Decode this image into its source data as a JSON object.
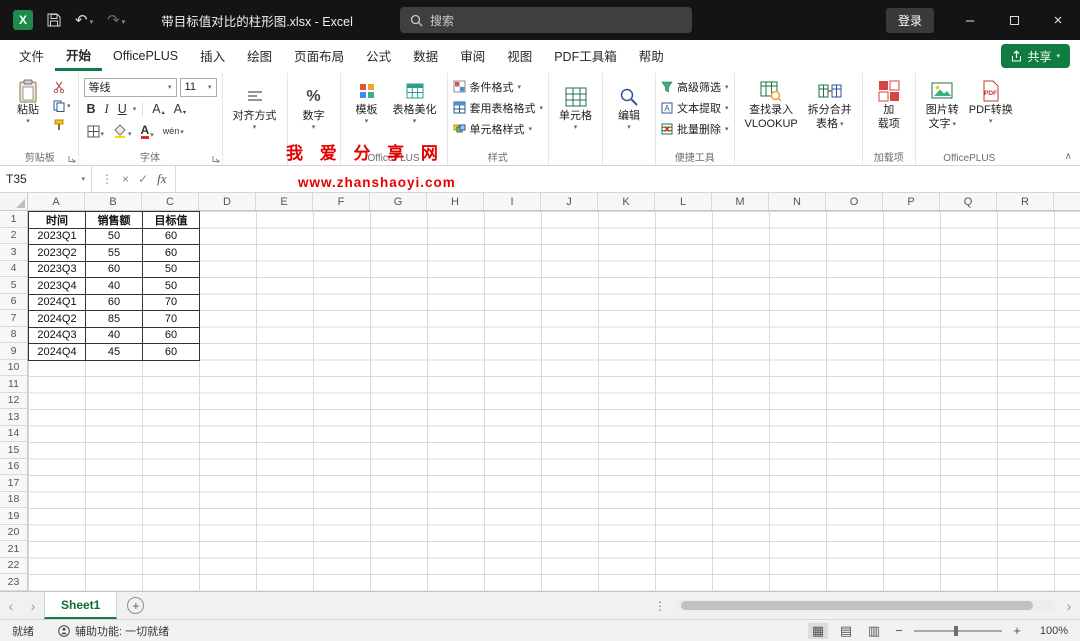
{
  "titlebar": {
    "app_icon_letter": "X",
    "title": "带目标值对比的柱形图.xlsx  -  Excel",
    "search_placeholder": "搜索",
    "signin_label": "登录"
  },
  "ribbon_tabs": [
    "文件",
    "开始",
    "OfficePLUS",
    "插入",
    "绘图",
    "页面布局",
    "公式",
    "数据",
    "审阅",
    "视图",
    "PDF工具箱",
    "帮助"
  ],
  "active_tab": "开始",
  "share_label": "共享",
  "ribbon": {
    "clipboard": {
      "paste": "粘贴",
      "group": "剪贴板"
    },
    "font": {
      "name": "等线",
      "size": "11",
      "group": "字体"
    },
    "align": {
      "label": "对齐方式"
    },
    "number": {
      "label": "数字"
    },
    "officeplus1": {
      "template": "模板",
      "beautify": "表格美化",
      "group": "OfficePLUS"
    },
    "styles": {
      "conditional": "条件格式",
      "format_table": "套用表格格式",
      "cell_styles": "单元格样式",
      "group": "样式"
    },
    "cells": {
      "label": "单元格"
    },
    "editing": {
      "label": "编辑"
    },
    "tools": {
      "advanced_filter": "高级筛选",
      "text_extract": "文本提取",
      "batch_delete": "批量删除",
      "group": "便捷工具"
    },
    "lookup": {
      "line1": "查找录入",
      "line2": "VLOOKUP"
    },
    "split": {
      "line1": "拆分合并",
      "line2": "表格"
    },
    "addins": {
      "line1": "加",
      "line2": "载项",
      "group": "加载项"
    },
    "officeplus2": {
      "img_line1": "图片转",
      "img_line2": "文字",
      "pdf": "PDF转换",
      "group": "OfficePLUS"
    }
  },
  "watermark": {
    "line1": "我 爱 分 享 网",
    "line2": "www.zhanshaoyi.com"
  },
  "formula_bar": {
    "name_box": "T35",
    "fx": "fx",
    "content": ""
  },
  "grid": {
    "columns": [
      "A",
      "B",
      "C",
      "D",
      "E",
      "F",
      "G",
      "H",
      "I",
      "J",
      "K",
      "L",
      "M",
      "N",
      "O",
      "P",
      "Q",
      "R"
    ],
    "row_count": 23,
    "table": {
      "headers": [
        "时间",
        "销售额",
        "目标值"
      ],
      "rows": [
        [
          "2023Q1",
          "50",
          "60"
        ],
        [
          "2023Q2",
          "55",
          "60"
        ],
        [
          "2023Q3",
          "60",
          "50"
        ],
        [
          "2023Q4",
          "40",
          "50"
        ],
        [
          "2024Q1",
          "60",
          "70"
        ],
        [
          "2024Q2",
          "85",
          "70"
        ],
        [
          "2024Q3",
          "40",
          "60"
        ],
        [
          "2024Q4",
          "45",
          "60"
        ]
      ]
    }
  },
  "sheet_tabbar": {
    "active_sheet": "Sheet1"
  },
  "status_bar": {
    "ready": "就绪",
    "accessibility": "辅助功能: 一切就绪",
    "zoom": "100%"
  }
}
